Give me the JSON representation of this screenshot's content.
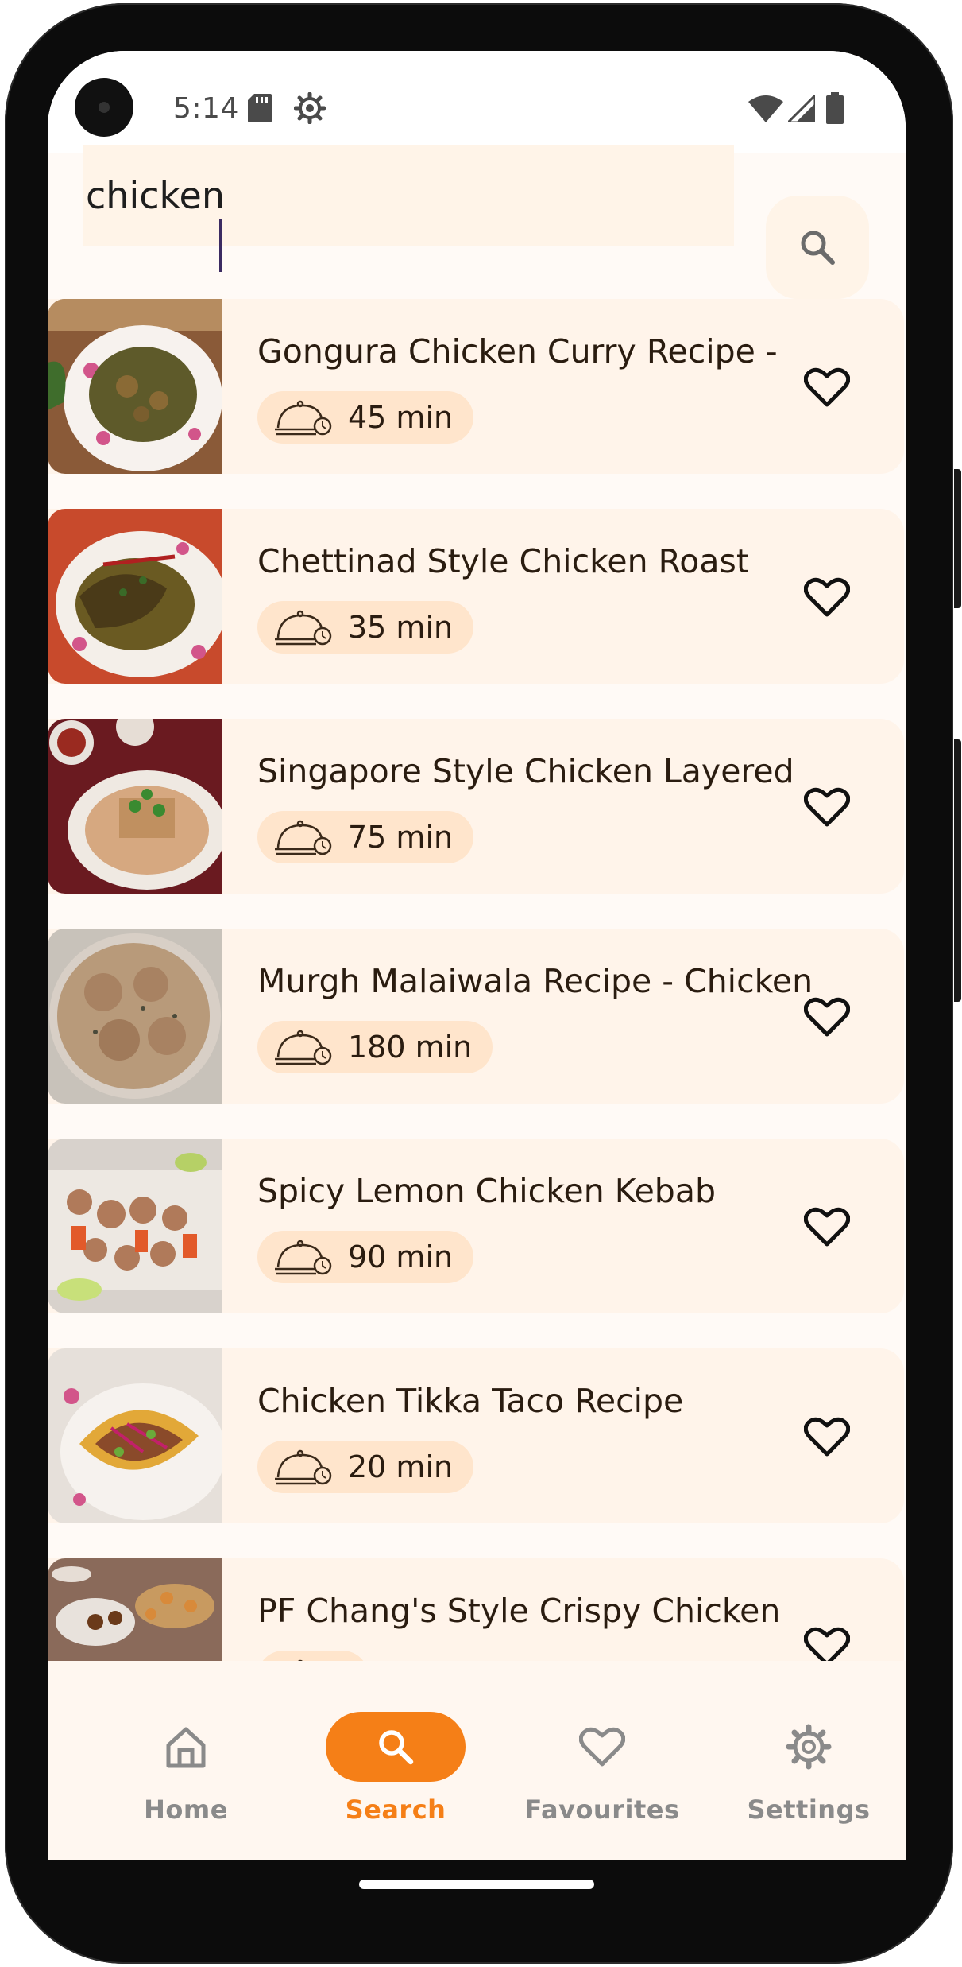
{
  "status_bar": {
    "time": "5:14",
    "icons": [
      "sd-card-icon",
      "settings-gear-status-icon",
      "wifi-icon",
      "cell-signal-icon",
      "battery-icon"
    ]
  },
  "search": {
    "value": "chicken",
    "placeholder": "",
    "button_icon": "search-icon"
  },
  "results": [
    {
      "title": "Gongura Chicken Curry Recipe -",
      "time": "45 min"
    },
    {
      "title": "Chettinad Style Chicken Roast",
      "time": "35 min"
    },
    {
      "title": "Singapore Style Chicken Layered",
      "time": "75 min"
    },
    {
      "title": "Murgh Malaiwala Recipe - Chicken",
      "time": "180 min"
    },
    {
      "title": "Spicy Lemon Chicken Kebab",
      "time": "90 min"
    },
    {
      "title": "Chicken Tikka Taco Recipe",
      "time": "20 min"
    },
    {
      "title": "PF Chang's Style Crispy Chicken",
      "time": ""
    }
  ],
  "bottom_nav": {
    "items": [
      {
        "label": "Home",
        "icon": "home-icon",
        "active": false
      },
      {
        "label": "Search",
        "icon": "search-icon",
        "active": true
      },
      {
        "label": "Favourites",
        "icon": "heart-icon",
        "active": false
      },
      {
        "label": "Settings",
        "icon": "gear-icon",
        "active": false
      }
    ]
  },
  "colors": {
    "accent": "#f57f17",
    "card_background": "#fff4ea",
    "chip_background": "#ffe5cc",
    "screen_background": "#fffaf6",
    "text_dark": "#2a1c10",
    "nav_inactive": "#8a8a8a"
  }
}
